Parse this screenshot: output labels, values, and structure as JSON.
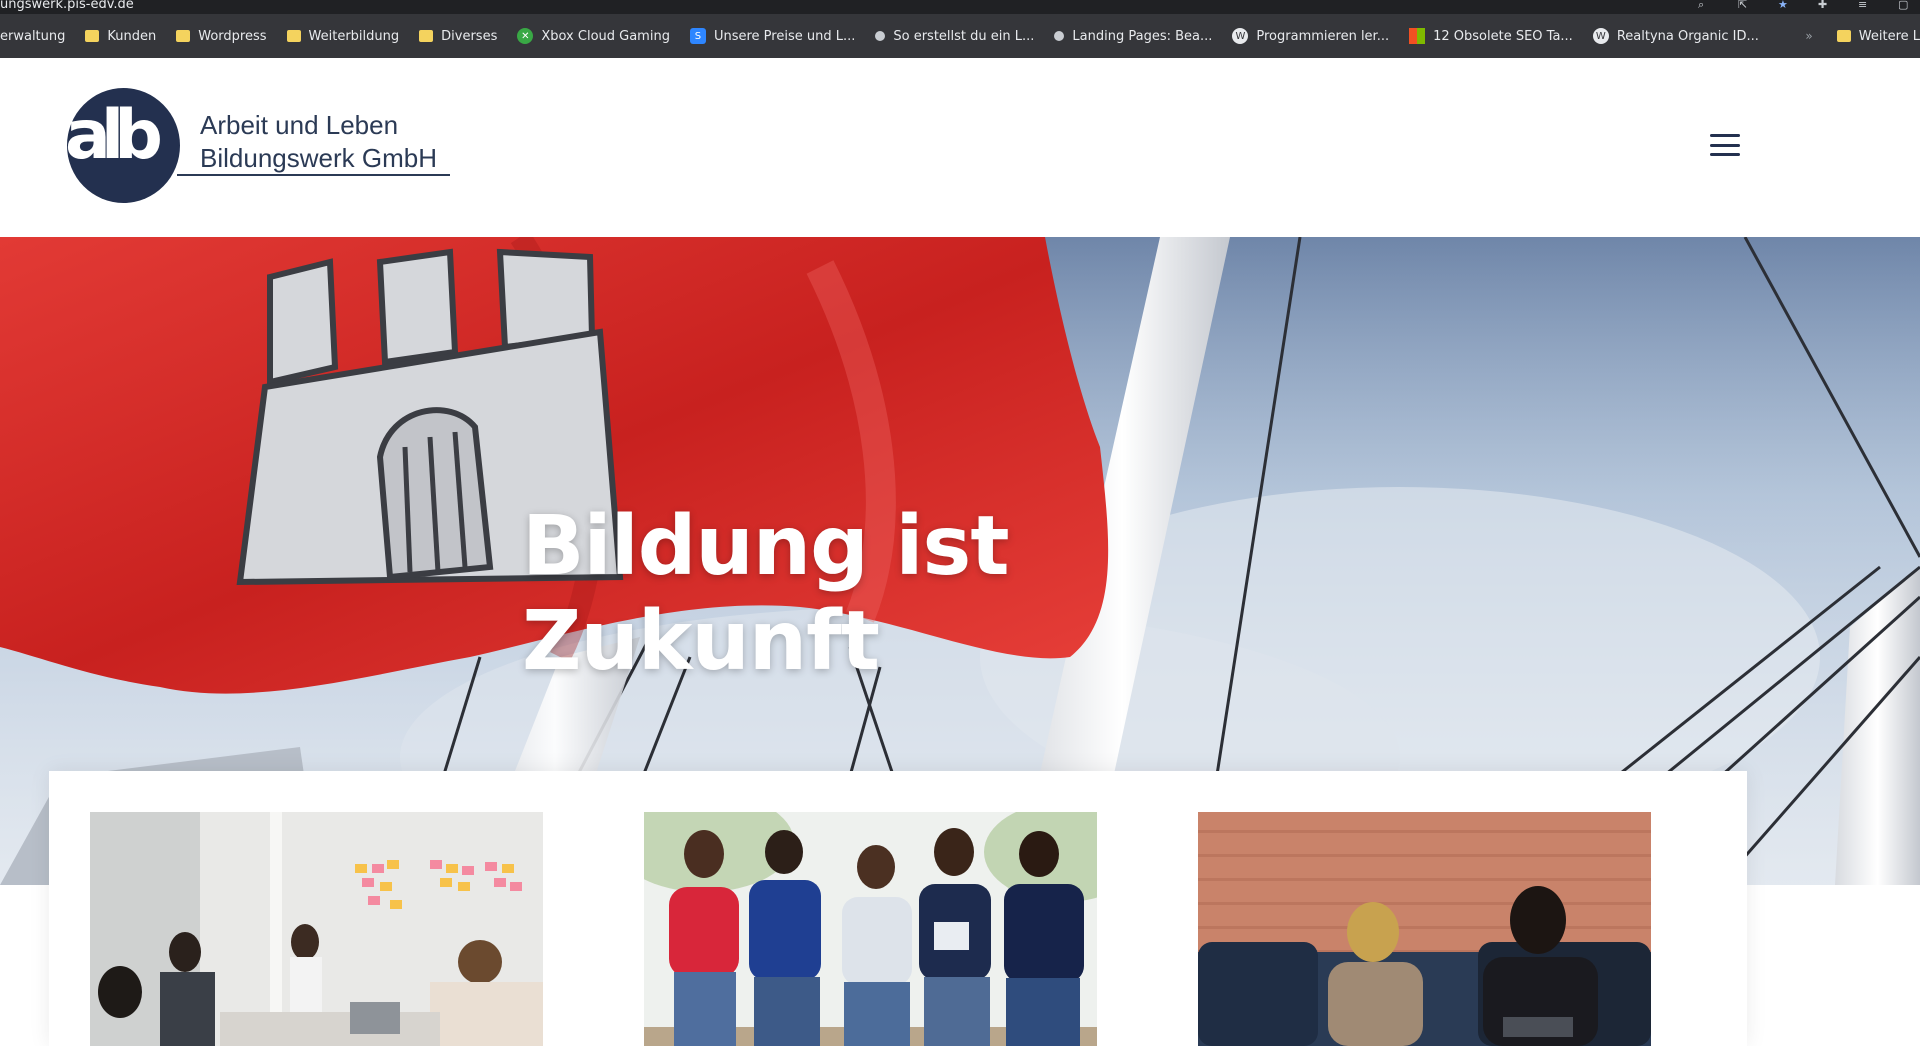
{
  "browser": {
    "url": "ungswerk.pis-edv.de",
    "bookmarks": [
      {
        "label": "erwaltung",
        "type": "text"
      },
      {
        "label": "Kunden",
        "type": "folder"
      },
      {
        "label": "Wordpress",
        "type": "folder"
      },
      {
        "label": "Weiterbildung",
        "type": "folder"
      },
      {
        "label": "Diverses",
        "type": "folder"
      },
      {
        "label": "Xbox Cloud Gaming",
        "type": "xbox"
      },
      {
        "label": "Unsere Preise und L...",
        "type": "site-s"
      },
      {
        "label": "So erstellst du ein L...",
        "type": "globe"
      },
      {
        "label": "Landing Pages: Bea...",
        "type": "globe"
      },
      {
        "label": "Programmieren ler...",
        "type": "wp"
      },
      {
        "label": "12 Obsolete SEO Ta...",
        "type": "ms"
      },
      {
        "label": "Realtyna Organic ID...",
        "type": "wp"
      }
    ],
    "more_label": "»",
    "other_bookmarks": "Weitere L"
  },
  "header": {
    "logo_letters": "alb",
    "logo_line1": "Arbeit und Leben",
    "logo_line2": "Bildungswerk GmbH",
    "menu_icon": "hamburger-menu-icon"
  },
  "hero": {
    "title": "Bildung ist Zukunft",
    "image": "hamburg-flag-on-ship-mast"
  },
  "cards": [
    {
      "image": "team-meeting-sticky-notes"
    },
    {
      "image": "group-of-young-people-smiling"
    },
    {
      "image": "two-women-in-conversation"
    }
  ],
  "colors": {
    "brand_navy": "#23304f",
    "flag_red": "#d92b2b"
  }
}
